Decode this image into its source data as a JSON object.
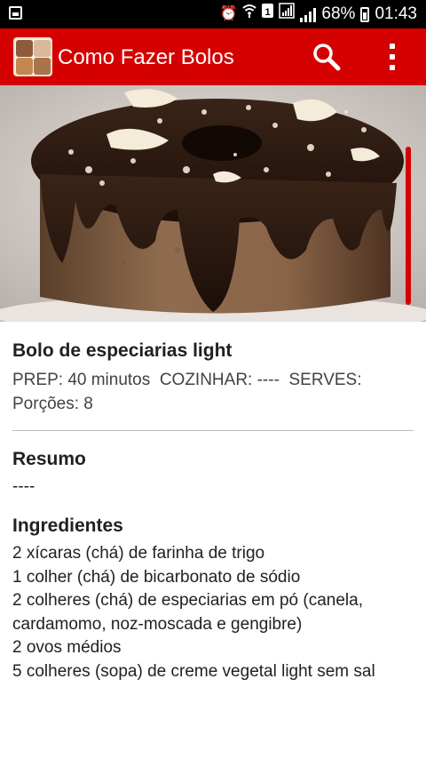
{
  "status_bar": {
    "battery": "68%",
    "time": "01:43"
  },
  "app_bar": {
    "title": "Como Fazer Bolos"
  },
  "recipe": {
    "title": "Bolo de especiarias light",
    "prep_label": "PREP:",
    "prep_value": "40 minutos",
    "cook_label": "COZINHAR:",
    "cook_value": "----",
    "serves_label": "SERVES:",
    "serves_value": "Porções: 8",
    "summary_heading": "Resumo",
    "summary_text": "----",
    "ingredients_heading": "Ingredientes",
    "ingredients": [
      "2 xícaras (chá) de farinha de trigo",
      "1 colher (chá) de bicarbonato de sódio",
      "2 colheres (chá) de especiarias em pó (canela, cardamomo, noz-moscada e gengibre)",
      "2 ovos médios",
      "5 colheres (sopa) de creme vegetal light sem sal"
    ]
  },
  "colors": {
    "app_bar": "#d50000",
    "status_bar": "#000000"
  }
}
